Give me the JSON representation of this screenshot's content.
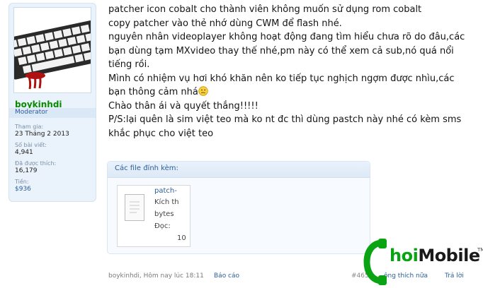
{
  "user": {
    "name": "boykinhdi",
    "role": "Moderator",
    "stats": [
      {
        "label": "Tham gia:",
        "value": "23 Tháng 2 2013"
      },
      {
        "label": "Số bài viết:",
        "value": "4,941"
      },
      {
        "label": "Đã được thích:",
        "value": "16,179"
      },
      {
        "label": "Tiền:",
        "value": "$936"
      }
    ]
  },
  "message": {
    "lines": [
      "patcher icon cobalt cho thành viên không muốn sử dụng rom cobalt",
      "copy patcher vào thẻ nhớ dùng CWM để flash nhé.",
      "nguyên nhân videoplayer không hoạt động đang tìm hiểu chưa rõ do đâu,các",
      "bạn dùng tạm MXvideo thay thế nhé,pm này có thể xem cả sub,nó quá nổi",
      "tiếng rồi.",
      "Mình có nhiệm vụ hơi khó khăn nên ko tiếp tục nghịch ngợm được nhìu,các",
      "bạn thông cảm nhá",
      "Chào thân ái và quyết thắng!!!!!",
      "P/S:lại quên là sim việt teo mà ko nt đc thì dùng pastch này nhé có kèm sms",
      "khắc phục cho việt teo"
    ],
    "smiley_icon": "confused-smiley-icon"
  },
  "attachments": {
    "title": "Các file đính kèm:",
    "file": {
      "name": "patch-",
      "size_label": "Kích th",
      "size_value": "bytes",
      "views_label": "Đọc:",
      "views_value": "10",
      "icon": "file-icon"
    }
  },
  "footer": {
    "author_time": "boykinhdi, Hôm nay lúc 18:11",
    "report": "Báo cáo",
    "post_number": "#465",
    "like_text": "ông thích nữa",
    "reply": "Trả lời"
  },
  "watermark": {
    "brand_green": "hoi",
    "brand_dark": "Mobile",
    "tm": "TM"
  },
  "colors": {
    "accent": "#2b5e9a",
    "username": "#0a8a00",
    "userbox_bg": "#eaf3fb",
    "brand_green": "#0aa313"
  }
}
